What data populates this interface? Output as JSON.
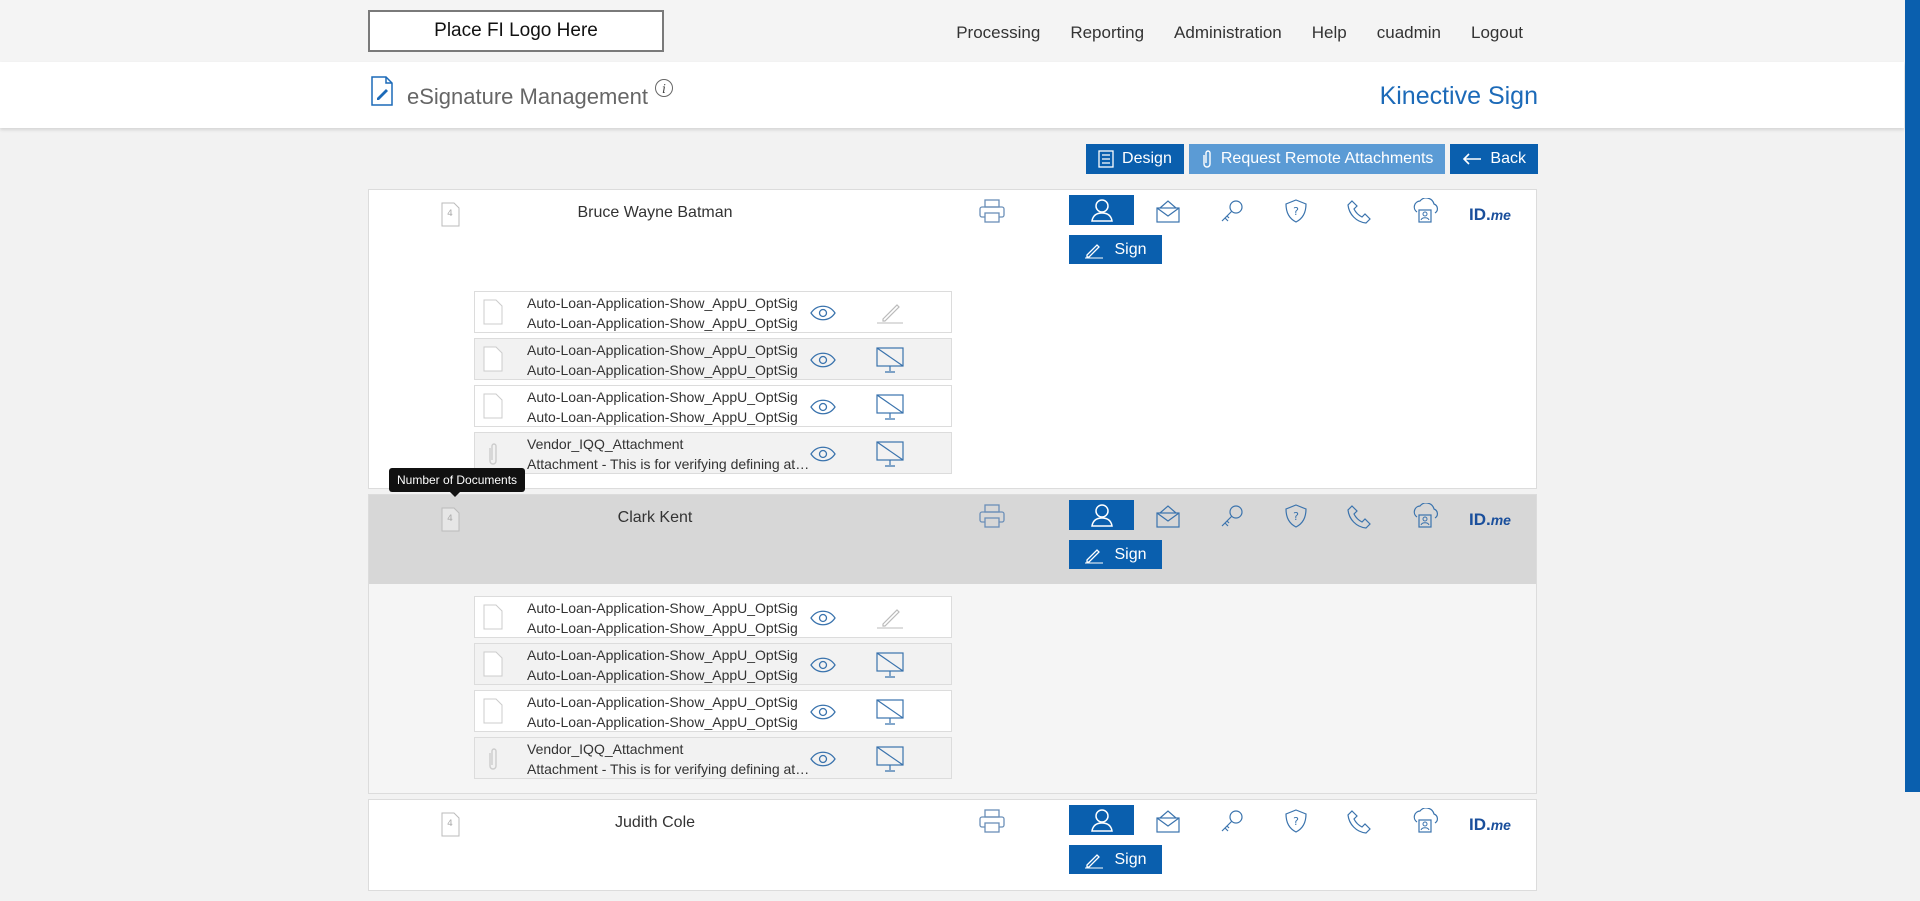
{
  "header": {
    "logo_text": "Place FI Logo Here",
    "nav": [
      "Processing",
      "Reporting",
      "Administration",
      "Help",
      "cuadmin",
      "Logout"
    ]
  },
  "titlebar": {
    "title": "eSignature Management",
    "brand": "Kinective Sign"
  },
  "actions": {
    "design": "Design",
    "request": "Request Remote Attachments",
    "back": "Back"
  },
  "tooltip": "Number of Documents",
  "signers": [
    {
      "name": "Bruce Wayne Batman",
      "doc_count": "4",
      "selected": false,
      "documents": [
        {
          "line1": "Auto-Loan-Application-Show_AppU_OptSig",
          "line2": "Auto-Loan-Application-Show_AppU_OptSig",
          "type": "document",
          "action": "sign-icon"
        },
        {
          "line1": "Auto-Loan-Application-Show_AppU_OptSig",
          "line2": "Auto-Loan-Application-Show_AppU_OptSig",
          "type": "document",
          "action": "no-display-icon"
        },
        {
          "line1": "Auto-Loan-Application-Show_AppU_OptSig",
          "line2": "Auto-Loan-Application-Show_AppU_OptSig",
          "type": "document",
          "action": "no-display-icon"
        },
        {
          "line1": "Vendor_IQQ_Attachment",
          "line2": "Attachment - This is for verifying defining attachment",
          "type": "attachment",
          "action": "no-display-icon"
        }
      ]
    },
    {
      "name": "Clark Kent",
      "doc_count": "4",
      "selected": true,
      "documents": [
        {
          "line1": "Auto-Loan-Application-Show_AppU_OptSig",
          "line2": "Auto-Loan-Application-Show_AppU_OptSig",
          "type": "document",
          "action": "sign-icon"
        },
        {
          "line1": "Auto-Loan-Application-Show_AppU_OptSig",
          "line2": "Auto-Loan-Application-Show_AppU_OptSig",
          "type": "document",
          "action": "no-display-icon"
        },
        {
          "line1": "Auto-Loan-Application-Show_AppU_OptSig",
          "line2": "Auto-Loan-Application-Show_AppU_OptSig",
          "type": "document",
          "action": "no-display-icon"
        },
        {
          "line1": "Vendor_IQQ_Attachment",
          "line2": "Attachment - This is for verifying defining attachment",
          "type": "attachment",
          "action": "no-display-icon"
        }
      ]
    },
    {
      "name": "Judith Cole",
      "doc_count": "4",
      "selected": false,
      "documents": []
    }
  ],
  "sign_label": "Sign",
  "idme": {
    "id": "ID.",
    "me": "me"
  },
  "auth_icons": [
    "in-person-icon",
    "email-icon",
    "key-icon",
    "security-question-icon",
    "phone-icon",
    "cloud-id-icon"
  ],
  "colors": {
    "primary": "#0a5fae",
    "light": "#5b9bd5",
    "brand": "#1c6ab8",
    "selected_row": "#d7d7d7"
  }
}
